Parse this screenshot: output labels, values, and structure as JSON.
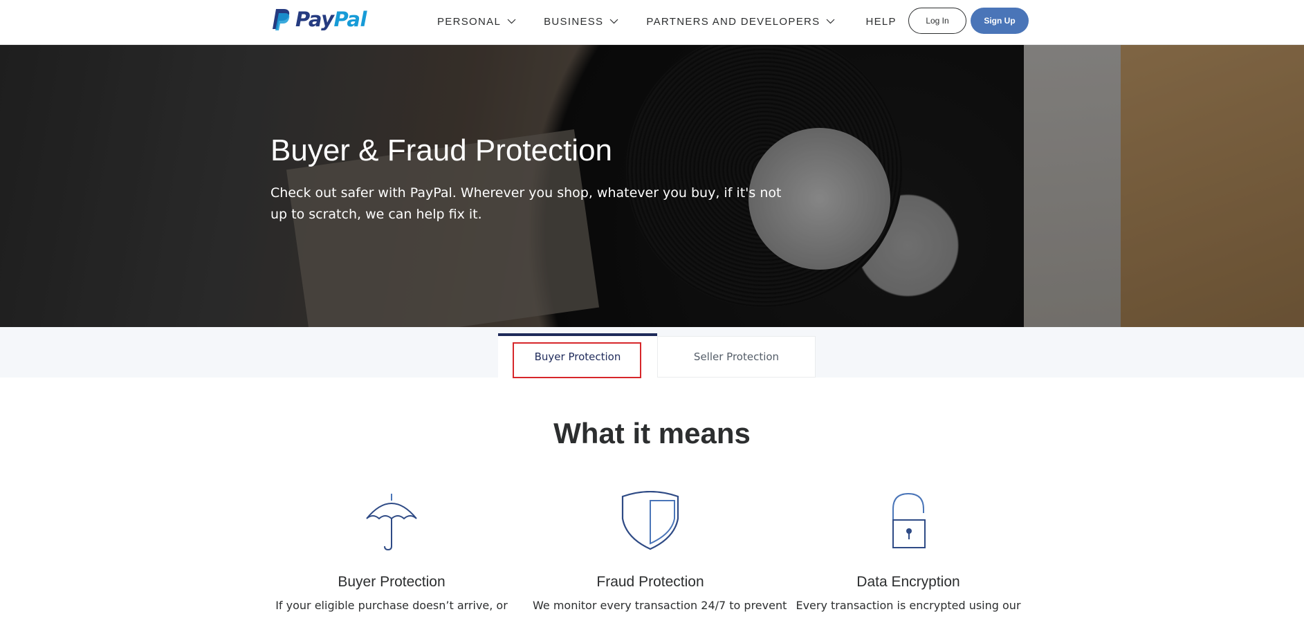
{
  "header": {
    "brand_pay": "Pay",
    "brand_pal": "Pal",
    "nav": [
      {
        "label": "PERSONAL"
      },
      {
        "label": "BUSINESS"
      },
      {
        "label": "PARTNERS AND DEVELOPERS"
      },
      {
        "label": "HELP"
      }
    ],
    "login_label": "Log In",
    "signup_label": "Sign Up"
  },
  "hero": {
    "title": "Buyer & Fraud Protection",
    "subtitle": "Check out safer with PayPal. Wherever you shop, whatever you buy, if it's not up to scratch, we can help fix it."
  },
  "tabs": [
    {
      "label": "Buyer Protection",
      "active": true
    },
    {
      "label": "Seller Protection",
      "active": false
    }
  ],
  "section": {
    "title": "What it means",
    "features": [
      {
        "icon": "umbrella-icon",
        "title": "Buyer Protection",
        "text": "If your eligible purchase doesn’t arrive, or"
      },
      {
        "icon": "shield-icon",
        "title": "Fraud Protection",
        "text": "We monitor every transaction 24/7 to prevent"
      },
      {
        "icon": "padlock-icon",
        "title": "Data Encryption",
        "text": "Every transaction is encrypted using our"
      }
    ]
  },
  "colors": {
    "brand_dark": "#253b80",
    "brand_light": "#179bd7",
    "signup_bg": "#4a75b8",
    "icon_blue": "#4a75b8",
    "highlight_red": "#d6262a"
  }
}
